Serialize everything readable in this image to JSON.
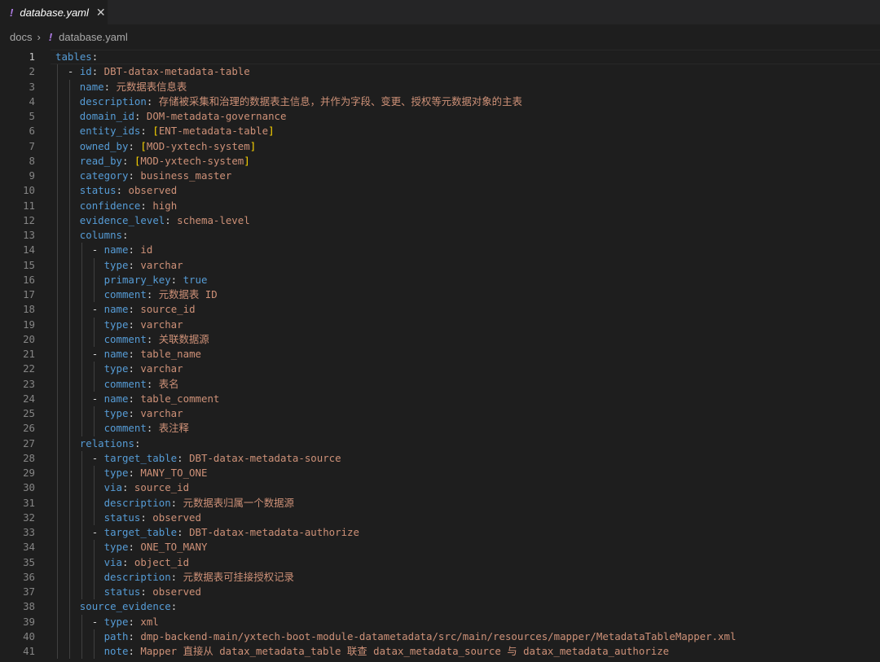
{
  "tab": {
    "icon": "yaml-icon",
    "glyph": "!",
    "filename": "database.yaml",
    "close_glyph": "✕"
  },
  "breadcrumb": {
    "folder": "docs",
    "separator": "›",
    "glyph": "!",
    "file": "database.yaml"
  },
  "editor": {
    "current_line": 1,
    "lines": [
      {
        "n": "1",
        "indent": 0,
        "dash": false,
        "key": "tables",
        "val": ""
      },
      {
        "n": "2",
        "indent": 1,
        "dash": true,
        "key": "id",
        "val": "DBT-datax-metadata-table"
      },
      {
        "n": "3",
        "indent": 2,
        "dash": false,
        "key": "name",
        "val": "元数据表信息表"
      },
      {
        "n": "4",
        "indent": 2,
        "dash": false,
        "key": "description",
        "val": "存储被采集和治理的数据表主信息，并作为字段、变更、授权等元数据对象的主表"
      },
      {
        "n": "5",
        "indent": 2,
        "dash": false,
        "key": "domain_id",
        "val": "DOM-metadata-governance"
      },
      {
        "n": "6",
        "indent": 2,
        "dash": false,
        "key": "entity_ids",
        "val": "ENT-metadata-table",
        "bracket": true
      },
      {
        "n": "7",
        "indent": 2,
        "dash": false,
        "key": "owned_by",
        "val": "MOD-yxtech-system",
        "bracket": true
      },
      {
        "n": "8",
        "indent": 2,
        "dash": false,
        "key": "read_by",
        "val": "MOD-yxtech-system",
        "bracket": true
      },
      {
        "n": "9",
        "indent": 2,
        "dash": false,
        "key": "category",
        "val": "business_master"
      },
      {
        "n": "10",
        "indent": 2,
        "dash": false,
        "key": "status",
        "val": "observed"
      },
      {
        "n": "11",
        "indent": 2,
        "dash": false,
        "key": "confidence",
        "val": "high"
      },
      {
        "n": "12",
        "indent": 2,
        "dash": false,
        "key": "evidence_level",
        "val": "schema-level"
      },
      {
        "n": "13",
        "indent": 2,
        "dash": false,
        "key": "columns",
        "val": ""
      },
      {
        "n": "14",
        "indent": 3,
        "dash": true,
        "key": "name",
        "val": "id"
      },
      {
        "n": "15",
        "indent": 4,
        "dash": false,
        "key": "type",
        "val": "varchar"
      },
      {
        "n": "16",
        "indent": 4,
        "dash": false,
        "key": "primary_key",
        "val": "true",
        "bool": true
      },
      {
        "n": "17",
        "indent": 4,
        "dash": false,
        "key": "comment",
        "val": "元数据表 ID"
      },
      {
        "n": "18",
        "indent": 3,
        "dash": true,
        "key": "name",
        "val": "source_id"
      },
      {
        "n": "19",
        "indent": 4,
        "dash": false,
        "key": "type",
        "val": "varchar"
      },
      {
        "n": "20",
        "indent": 4,
        "dash": false,
        "key": "comment",
        "val": "关联数据源"
      },
      {
        "n": "21",
        "indent": 3,
        "dash": true,
        "key": "name",
        "val": "table_name"
      },
      {
        "n": "22",
        "indent": 4,
        "dash": false,
        "key": "type",
        "val": "varchar"
      },
      {
        "n": "23",
        "indent": 4,
        "dash": false,
        "key": "comment",
        "val": "表名"
      },
      {
        "n": "24",
        "indent": 3,
        "dash": true,
        "key": "name",
        "val": "table_comment"
      },
      {
        "n": "25",
        "indent": 4,
        "dash": false,
        "key": "type",
        "val": "varchar"
      },
      {
        "n": "26",
        "indent": 4,
        "dash": false,
        "key": "comment",
        "val": "表注释"
      },
      {
        "n": "27",
        "indent": 2,
        "dash": false,
        "key": "relations",
        "val": ""
      },
      {
        "n": "28",
        "indent": 3,
        "dash": true,
        "key": "target_table",
        "val": "DBT-datax-metadata-source"
      },
      {
        "n": "29",
        "indent": 4,
        "dash": false,
        "key": "type",
        "val": "MANY_TO_ONE"
      },
      {
        "n": "30",
        "indent": 4,
        "dash": false,
        "key": "via",
        "val": "source_id"
      },
      {
        "n": "31",
        "indent": 4,
        "dash": false,
        "key": "description",
        "val": "元数据表归属一个数据源"
      },
      {
        "n": "32",
        "indent": 4,
        "dash": false,
        "key": "status",
        "val": "observed"
      },
      {
        "n": "33",
        "indent": 3,
        "dash": true,
        "key": "target_table",
        "val": "DBT-datax-metadata-authorize"
      },
      {
        "n": "34",
        "indent": 4,
        "dash": false,
        "key": "type",
        "val": "ONE_TO_MANY"
      },
      {
        "n": "35",
        "indent": 4,
        "dash": false,
        "key": "via",
        "val": "object_id"
      },
      {
        "n": "36",
        "indent": 4,
        "dash": false,
        "key": "description",
        "val": "元数据表可挂接授权记录"
      },
      {
        "n": "37",
        "indent": 4,
        "dash": false,
        "key": "status",
        "val": "observed"
      },
      {
        "n": "38",
        "indent": 2,
        "dash": false,
        "key": "source_evidence",
        "val": ""
      },
      {
        "n": "39",
        "indent": 3,
        "dash": true,
        "key": "type",
        "val": "xml"
      },
      {
        "n": "40",
        "indent": 4,
        "dash": false,
        "key": "path",
        "val": "dmp-backend-main/yxtech-boot-module-datametadata/src/main/resources/mapper/MetadataTableMapper.xml"
      },
      {
        "n": "41",
        "indent": 4,
        "dash": false,
        "key": "note",
        "val": "Mapper 直接从 datax_metadata_table 联查 datax_metadata_source 与 datax_metadata_authorize"
      }
    ]
  },
  "colors": {
    "key": "#569cd6",
    "string": "#ce9178",
    "bracket": "#ffd700",
    "accent": "#b37feb"
  }
}
